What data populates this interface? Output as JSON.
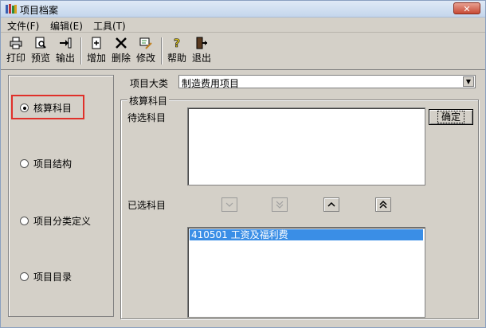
{
  "window": {
    "title": "项目档案"
  },
  "menu": {
    "items": [
      "文件(F)",
      "编辑(E)",
      "工具(T)"
    ]
  },
  "toolbar": {
    "print": "打印",
    "preview": "预览",
    "export": "输出",
    "add": "增加",
    "delete": "删除",
    "modify": "修改",
    "help": "帮助",
    "exit": "退出"
  },
  "left_options": {
    "items": [
      {
        "label": "核算科目",
        "selected": true
      },
      {
        "label": "项目结构",
        "selected": false
      },
      {
        "label": "项目分类定义",
        "selected": false
      },
      {
        "label": "项目目录",
        "selected": false
      }
    ]
  },
  "category": {
    "label": "项目大类",
    "value": "制造费用项目"
  },
  "group": {
    "title": "核算科目",
    "candidates_label": "待选科目",
    "selected_label": "已选科目",
    "ok_button": "确定",
    "candidates": [],
    "selected": [
      {
        "code": "410501",
        "name": "工资及福利费",
        "text": "410501  工资及福利费",
        "highlighted": true
      }
    ]
  },
  "close_glyph": "✕"
}
